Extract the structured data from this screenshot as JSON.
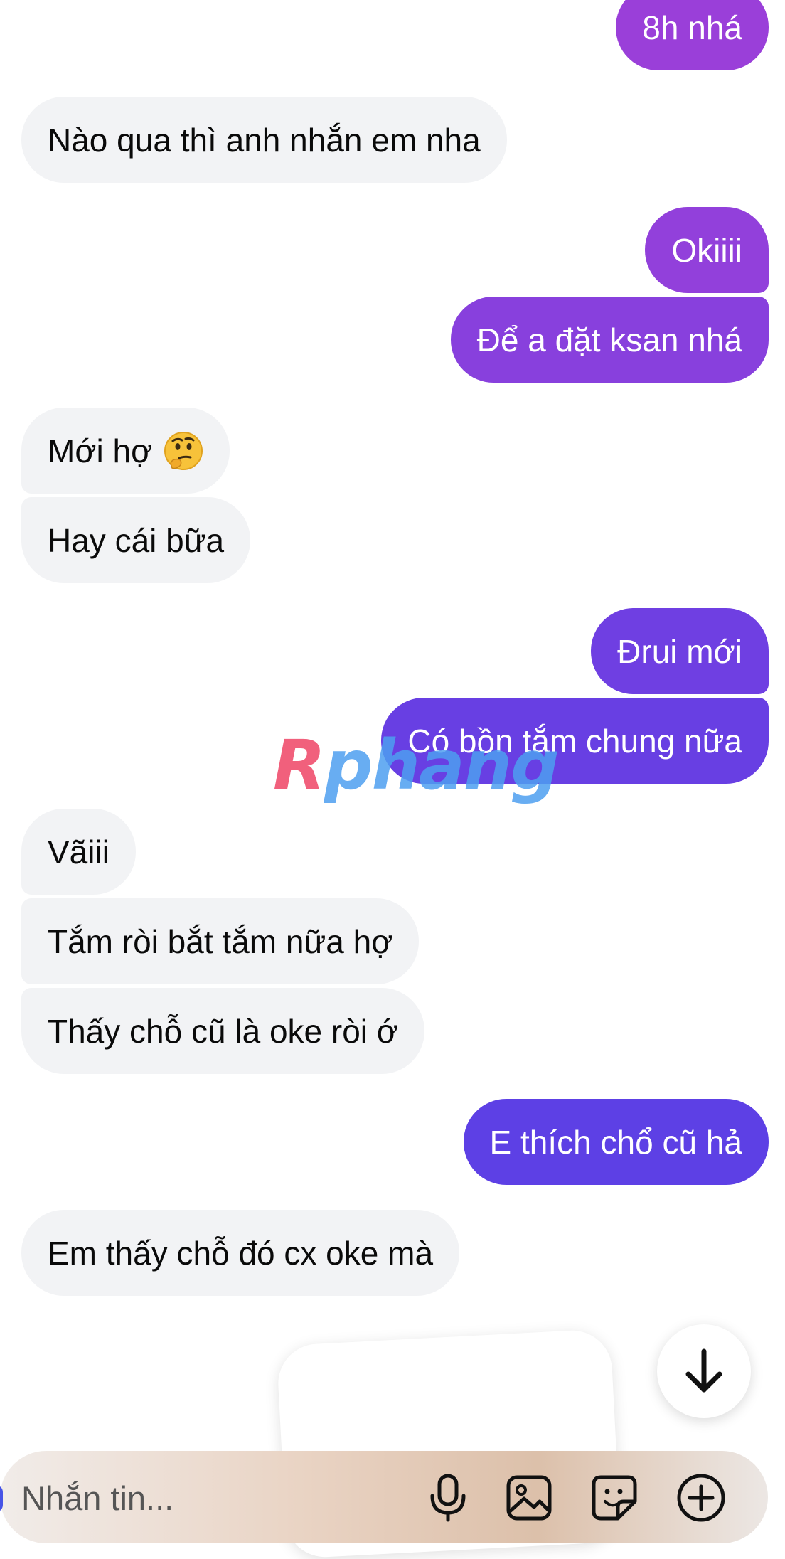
{
  "messages": [
    {
      "side": "out",
      "text": "8h nhá"
    },
    {
      "side": "in",
      "text": "Nào qua thì anh nhắn em nha"
    },
    {
      "side": "out",
      "text": "Okiiii"
    },
    {
      "side": "out",
      "text": "Để a đặt ksan nhá"
    },
    {
      "side": "in",
      "text": "Mới hợ",
      "emoji": "thinking-face"
    },
    {
      "side": "in",
      "text": "Hay cái bữa"
    },
    {
      "side": "out",
      "text": "Đrui mới"
    },
    {
      "side": "out",
      "text": "Có bồn tắm chung nữa"
    },
    {
      "side": "in",
      "text": "Vãiii"
    },
    {
      "side": "in",
      "text": "Tắm ròi bắt tắm nữa hợ"
    },
    {
      "side": "in",
      "text": "Thấy chỗ cũ là oke ròi ớ"
    },
    {
      "side": "out",
      "text": "E thích chổ cũ hả"
    },
    {
      "side": "in",
      "text": "Em thấy chỗ đó cx oke mà"
    }
  ],
  "watermark": {
    "first": "R",
    "rest": "phang"
  },
  "composer": {
    "placeholder": "Nhắn tin...",
    "tools": [
      "microphone-icon",
      "image-icon",
      "sticker-icon",
      "plus-circle-icon"
    ]
  },
  "scroll_button_icon": "arrow-down-icon",
  "colors": {
    "incoming_bubble": "#f2f3f5",
    "outgoing_gradient_top": "#9b3fd8",
    "outgoing_gradient_bottom": "#5a3ee6",
    "outgoing_text": "#ffffff",
    "incoming_text": "#0a0a0a"
  }
}
